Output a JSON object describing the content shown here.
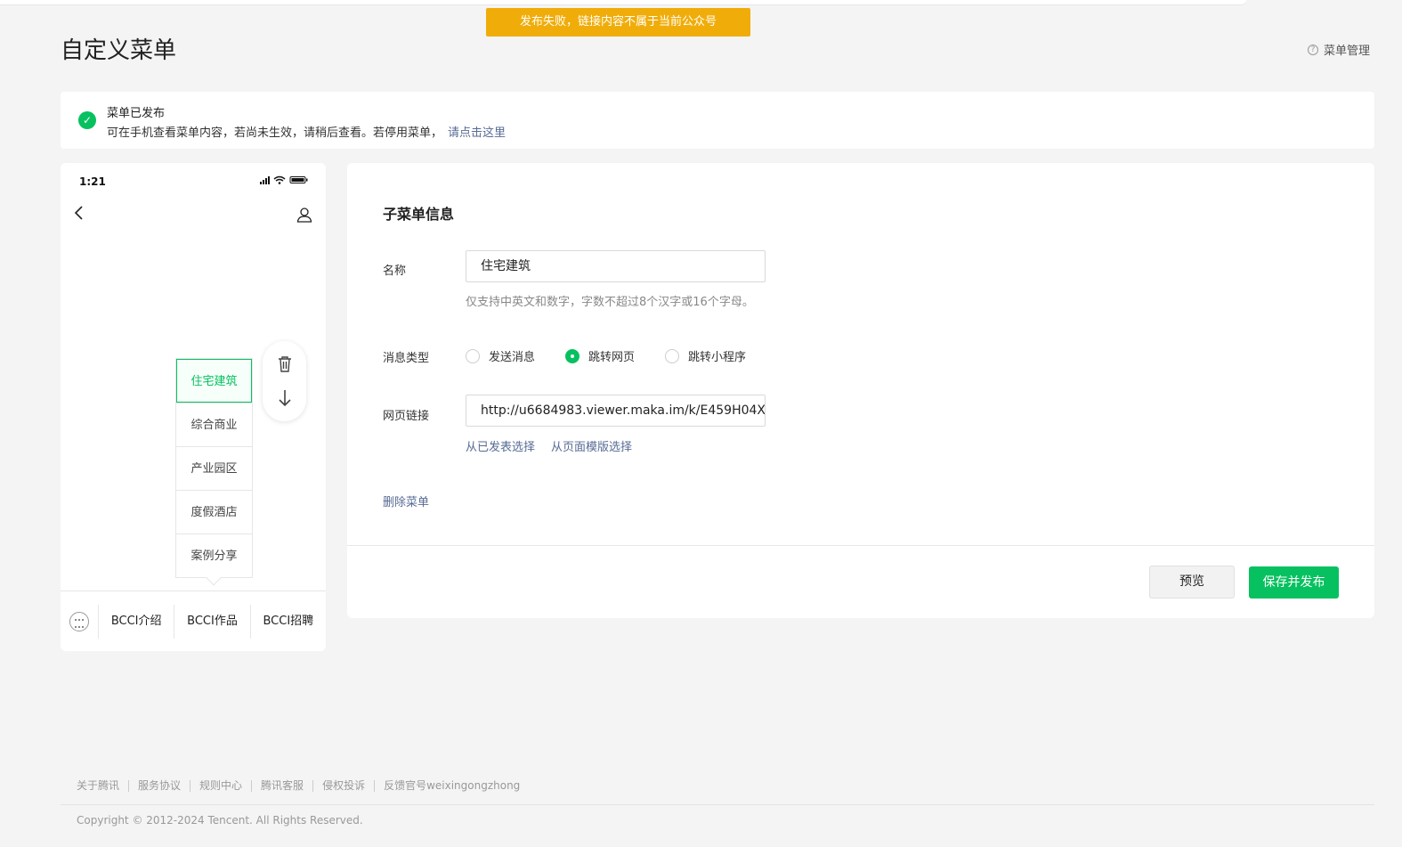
{
  "toast": {
    "text": "发布失败，链接内容不属于当前公众号"
  },
  "header": {
    "title": "自定义菜单",
    "help_label": "菜单管理"
  },
  "notice": {
    "title": "菜单已发布",
    "description": "可在手机查看菜单内容，若尚未生效，请稍后查看。若停用菜单，",
    "link_label": "请点击这里"
  },
  "phone": {
    "time": "1:21",
    "submenu": [
      "住宅建筑",
      "综合商业",
      "产业园区",
      "度假酒店",
      "案例分享"
    ],
    "menubar": [
      "BCCI介绍",
      "BCCI作品",
      "BCCI招聘"
    ]
  },
  "editor": {
    "title": "子菜单信息",
    "name_label": "名称",
    "name_value": "住宅建筑",
    "name_hint": "仅支持中英文和数字，字数不超过8个汉字或16个字母。",
    "type_label": "消息类型",
    "type_options": [
      "发送消息",
      "跳转网页",
      "跳转小程序"
    ],
    "type_selected": "跳转网页",
    "url_label": "网页链接",
    "url_value": "http://u6684983.viewer.maka.im/k/E459H04X",
    "url_link_published": "从已发表选择",
    "url_link_template": "从页面模版选择",
    "delete_label": "删除菜单",
    "preview_label": "预览",
    "publish_label": "保存并发布"
  },
  "footer": {
    "links": [
      "关于腾讯",
      "服务协议",
      "规则中心",
      "腾讯客服",
      "侵权投诉",
      "反馈官号weixingongzhong"
    ],
    "copyright": "Copyright © 2012-2024 Tencent. All Rights Reserved."
  },
  "colors": {
    "accent": "#07c160",
    "link": "#576b95",
    "warning": "#f0ad0a"
  }
}
